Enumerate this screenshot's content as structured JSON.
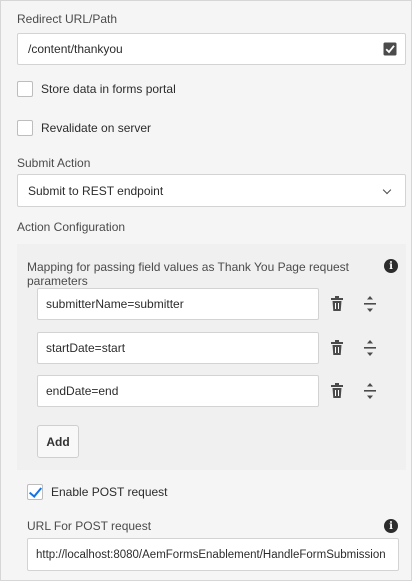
{
  "redirect": {
    "label": "Redirect URL/Path",
    "value": "/content/thankyou"
  },
  "store_data": {
    "label": "Store data in forms portal",
    "checked": false
  },
  "revalidate": {
    "label": "Revalidate on server",
    "checked": false
  },
  "submit_action": {
    "label": "Submit Action",
    "selected": "Submit to REST endpoint"
  },
  "action_config": {
    "label": "Action Configuration",
    "mapping_label": "Mapping for passing field values as Thank You Page request parameters",
    "rows": [
      {
        "value": "submitterName=submitter"
      },
      {
        "value": "startDate=start"
      },
      {
        "value": "endDate=end"
      }
    ],
    "add_label": "Add"
  },
  "enable_post": {
    "label": "Enable POST request",
    "checked": true
  },
  "post_url": {
    "label": "URL For POST request",
    "value": "http://localhost:8080/AemFormsEnablement/HandleFormSubmission"
  },
  "colors": {
    "accent": "#1473e6",
    "panel_bg": "#f5f5f5"
  },
  "icons": [
    "check-icon",
    "chevron-down-icon",
    "info-icon",
    "trash-icon",
    "reorder-icon"
  ]
}
